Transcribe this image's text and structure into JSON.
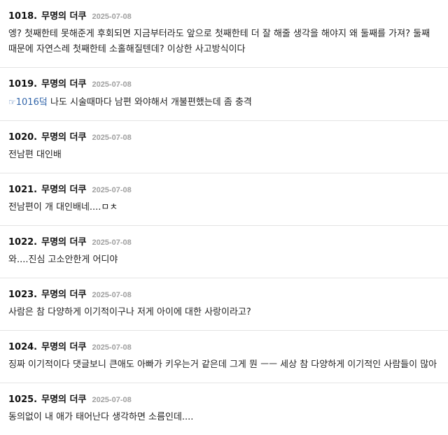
{
  "comments": [
    {
      "number": "1018.",
      "author": "무명의 더쿠",
      "date": "2025-07-08",
      "text": "엥? 첫째한테 못해준게 후회되면 지금부터라도 앞으로 첫째한테 더 잘 해줄 생각을 해야지 왜 둘째를 가져? 둘째 때문에 자연스레 첫째한테 소홀해질텐데? 이상한 사고방식이다"
    },
    {
      "number": "1019.",
      "author": "무명의 더쿠",
      "date": "2025-07-08",
      "reply_icon": "pointing-hand-icon",
      "reply_ref": "1016덬",
      "text": " 나도 시술때마다 남편 와야해서 개불편했는데 좀 충격"
    },
    {
      "number": "1020.",
      "author": "무명의 더쿠",
      "date": "2025-07-08",
      "text": "전남편 대인배"
    },
    {
      "number": "1021.",
      "author": "무명의 더쿠",
      "date": "2025-07-08",
      "text": "전남편이 개 대인배네....ㅁㅊ"
    },
    {
      "number": "1022.",
      "author": "무명의 더쿠",
      "date": "2025-07-08",
      "text": "와....진심 고소안한게 어디야"
    },
    {
      "number": "1023.",
      "author": "무명의 더쿠",
      "date": "2025-07-08",
      "text": "사람은 참 다양하게 이기적이구나 저게 아이에 대한 사랑이라고?"
    },
    {
      "number": "1024.",
      "author": "무명의 더쿠",
      "date": "2025-07-08",
      "text": "징짜 이기적이다 댓글보니 큰애도 아빠가 키우는거 같은데 그게 뭔 ㅡㅡ 세상 참 다양하게 이기적인 사람들이 많아"
    },
    {
      "number": "1025.",
      "author": "무명의 더쿠",
      "date": "2025-07-08",
      "text": "동의없이 내 애가 태어난다 생각하면 소름인데...."
    }
  ]
}
